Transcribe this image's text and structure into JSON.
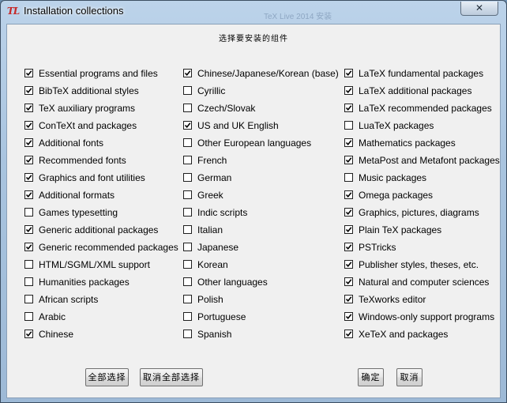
{
  "window": {
    "title": "Installation collections",
    "ghost_title": "TeX Live 2014 安装",
    "close_symbol": "✕"
  },
  "heading": "选择要安装的组件",
  "columns": [
    [
      {
        "label": "Essential programs and files",
        "checked": true
      },
      {
        "label": "BibTeX additional styles",
        "checked": true
      },
      {
        "label": "TeX auxiliary programs",
        "checked": true
      },
      {
        "label": "ConTeXt and packages",
        "checked": true
      },
      {
        "label": "Additional fonts",
        "checked": true
      },
      {
        "label": "Recommended fonts",
        "checked": true
      },
      {
        "label": "Graphics and font utilities",
        "checked": true
      },
      {
        "label": "Additional formats",
        "checked": true
      },
      {
        "label": "Games typesetting",
        "checked": false
      },
      {
        "label": "Generic additional packages",
        "checked": true
      },
      {
        "label": "Generic recommended packages",
        "checked": true
      },
      {
        "label": "HTML/SGML/XML support",
        "checked": false
      },
      {
        "label": "Humanities packages",
        "checked": false
      },
      {
        "label": "African scripts",
        "checked": false
      },
      {
        "label": "Arabic",
        "checked": false
      },
      {
        "label": "Chinese",
        "checked": true
      }
    ],
    [
      {
        "label": "Chinese/Japanese/Korean (base)",
        "checked": true
      },
      {
        "label": "Cyrillic",
        "checked": false
      },
      {
        "label": "Czech/Slovak",
        "checked": false
      },
      {
        "label": "US and UK English",
        "checked": true
      },
      {
        "label": "Other European languages",
        "checked": false
      },
      {
        "label": "French",
        "checked": false
      },
      {
        "label": "German",
        "checked": false
      },
      {
        "label": "Greek",
        "checked": false
      },
      {
        "label": "Indic scripts",
        "checked": false
      },
      {
        "label": "Italian",
        "checked": false
      },
      {
        "label": "Japanese",
        "checked": false
      },
      {
        "label": "Korean",
        "checked": false
      },
      {
        "label": "Other languages",
        "checked": false
      },
      {
        "label": "Polish",
        "checked": false
      },
      {
        "label": "Portuguese",
        "checked": false
      },
      {
        "label": "Spanish",
        "checked": false
      }
    ],
    [
      {
        "label": "LaTeX fundamental packages",
        "checked": true
      },
      {
        "label": "LaTeX additional packages",
        "checked": true
      },
      {
        "label": "LaTeX recommended packages",
        "checked": true
      },
      {
        "label": "LuaTeX packages",
        "checked": false
      },
      {
        "label": "Mathematics packages",
        "checked": true
      },
      {
        "label": "MetaPost and Metafont packages",
        "checked": true
      },
      {
        "label": "Music packages",
        "checked": false
      },
      {
        "label": "Omega packages",
        "checked": true
      },
      {
        "label": "Graphics, pictures, diagrams",
        "checked": true
      },
      {
        "label": "Plain TeX packages",
        "checked": true
      },
      {
        "label": "PSTricks",
        "checked": true
      },
      {
        "label": "Publisher styles, theses, etc.",
        "checked": true
      },
      {
        "label": "Natural and computer sciences",
        "checked": true
      },
      {
        "label": "TeXworks editor",
        "checked": true
      },
      {
        "label": "Windows-only support programs",
        "checked": true
      },
      {
        "label": "XeTeX and packages",
        "checked": true
      }
    ]
  ],
  "buttons": {
    "select_all": "全部选择",
    "deselect_all": "取消全部选择",
    "ok": "确定",
    "cancel": "取消"
  }
}
